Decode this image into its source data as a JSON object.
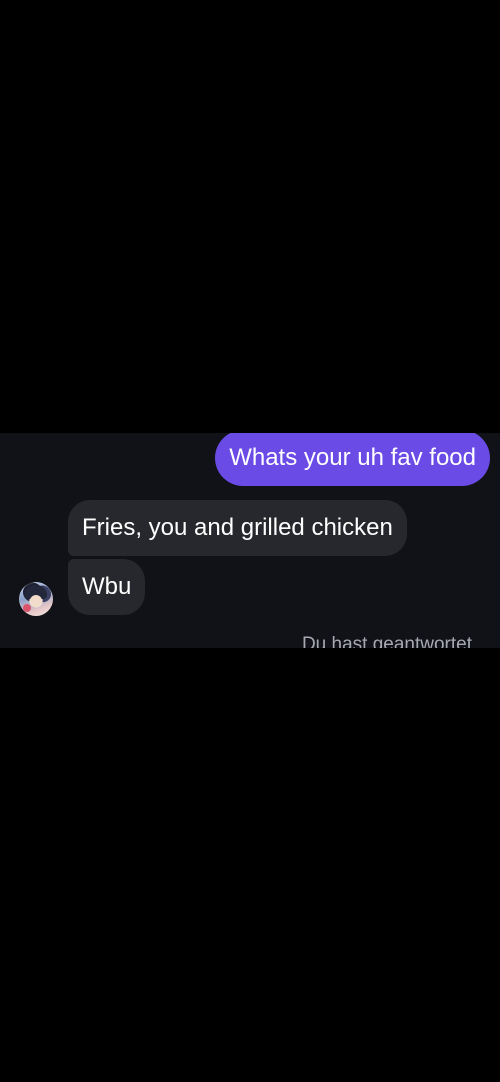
{
  "messages": {
    "outgoing_1": "Whats your uh fav food",
    "incoming_1": "Fries, you and grilled chicken",
    "incoming_2": "Wbu"
  },
  "status": {
    "reply_text": "Du hast geantwortet"
  },
  "colors": {
    "outgoing_bubble": "#6b4be6",
    "incoming_bubble": "#26282d",
    "chat_background": "#101217"
  },
  "icons": {
    "avatar": "contact-avatar"
  }
}
